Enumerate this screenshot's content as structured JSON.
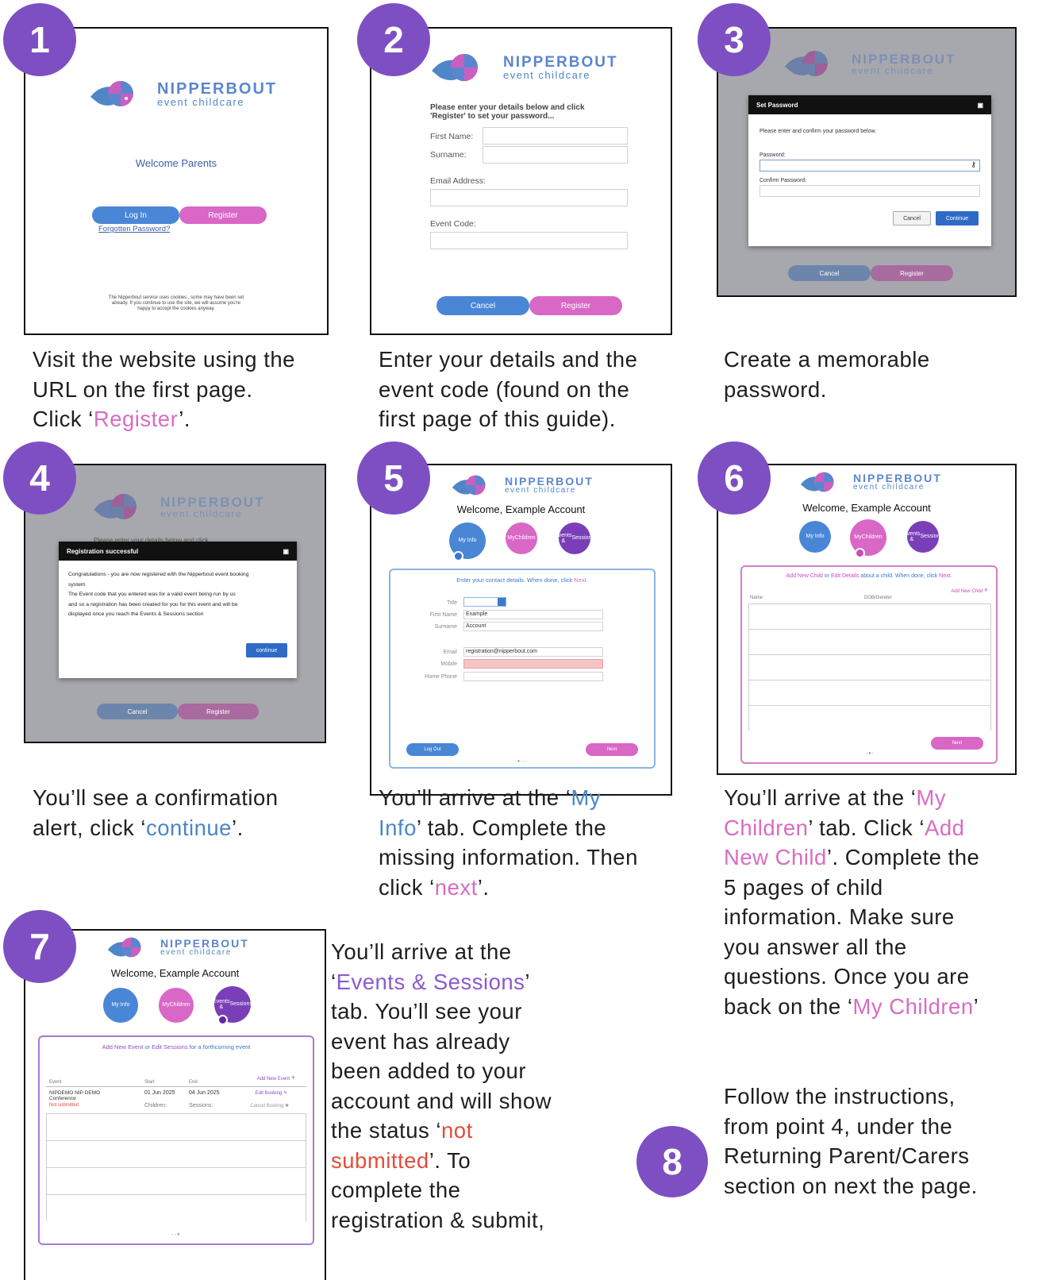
{
  "logo": {
    "name": "NIPPERBOUT",
    "sub": "event childcare"
  },
  "steps": [
    {
      "num": "1",
      "caption": [
        "Visit the website using the",
        "URL on the first page.",
        "Click ‘",
        "Register",
        "’."
      ]
    },
    {
      "num": "2",
      "caption": [
        "Enter your details and the",
        "event code (found on the",
        "first page of this guide)."
      ]
    },
    {
      "num": "3",
      "caption": [
        "Create a memorable",
        "password."
      ]
    },
    {
      "num": "4",
      "caption": [
        "You’ll see a confirmation",
        "alert, click ‘",
        "continue",
        "’."
      ]
    },
    {
      "num": "5",
      "caption": [
        "You’ll arrive at the ‘",
        "My",
        "Info",
        "’ tab.  Complete the",
        "missing information. Then",
        "click ‘",
        "next",
        "’."
      ]
    },
    {
      "num": "6",
      "caption": [
        "You’ll arrive at the ‘",
        "My",
        "Children",
        "’ tab.  Click ‘",
        "Add",
        "New Child",
        "’. Complete the",
        "5 pages of child",
        "information. Make sure",
        "you answer all the",
        "questions. Once you are",
        "back on the ‘",
        "My Children",
        "’"
      ]
    },
    {
      "num": "7",
      "caption": [
        "You’ll arrive at the",
        "‘",
        "Events & Sessions",
        "’",
        "tab.  You’ll see your",
        "event has already",
        "been added to your",
        "account and will show",
        "the status ‘",
        "not",
        "submitted",
        "’.  To",
        "complete the",
        "registration & submit,"
      ]
    },
    {
      "num": "8",
      "caption": [
        "Follow the instructions,",
        "from point 4, under the",
        "Returning Parent/Carers",
        "section on next the page."
      ]
    }
  ],
  "s1": {
    "welcome": "Welcome Parents",
    "login": "Log In",
    "register": "Register",
    "forgot": "Forgotten Password?",
    "cookie": [
      "The Nipperbout service uses cookies , some may have been set",
      "already. If you continue to use the site, we will assume you're",
      "happy to accept the cookies anyway."
    ]
  },
  "s2": {
    "intro": [
      "Please enter your details below and click",
      "'Register' to set your password..."
    ],
    "first": "First Name:",
    "surname": "Surname:",
    "email": "Email Address:",
    "code": "Event Code:",
    "cancel": "Cancel",
    "register": "Register"
  },
  "s3": {
    "title": "Set Password",
    "intro": "Please enter and confirm your password below.",
    "password": "Password:",
    "confirm": "Confirm Password:",
    "cancel": "Cancel",
    "continue": "Continue",
    "bg_cancel": "Cancel",
    "bg_register": "Register"
  },
  "s4": {
    "title": "Registration successful",
    "lines": [
      "Congratulations - you are now registered with the Nipperbout event booking",
      "system",
      "The Event code that you entered was for a valid event being run by us",
      "and so a registration has been created for you for this event and will be",
      "displayed once you reach the Events & Sessions section"
    ],
    "bg_text": "Please enter your details below and click",
    "continue": "continue",
    "bg_cancel": "Cancel",
    "bg_register": "Register"
  },
  "account": {
    "welcome": "Welcome, Example Account",
    "myinfo": "My Info",
    "mychildren": [
      "My",
      "Children"
    ],
    "events": [
      "Events &",
      "Sessions"
    ]
  },
  "s5": {
    "instr": "Enter your contact details.  When done, click ",
    "instr_next": "Next.",
    "title": "Title",
    "first": "First Name",
    "first_val": "Example",
    "surname": "Surname",
    "surname_val": "Account",
    "email": "Email",
    "email_val": "registration@nipperbout.com",
    "mobile": "Mobile",
    "home": "Home Phone",
    "logout": "Log Out",
    "next": "Next"
  },
  "s6": {
    "instr_a": "Add New Child",
    "instr_b": " or ",
    "instr_c": "Edit Details",
    "instr_d": " about a child. When done, click ",
    "instr_e": "Next.",
    "add": "Add New Child",
    "col_name": "Name",
    "col_dob": "DOB/Gender",
    "next": "Next"
  },
  "s7": {
    "instr_a": "Add New Event",
    "instr_b": " or ",
    "instr_c": "Edit Sessions",
    "instr_d": " for a forthcoming event",
    "add": "Add New Event",
    "col_event": "Event",
    "col_start": "Start",
    "col_end": "End",
    "event_name": [
      "NIPDEMO NIP DEMO",
      "Conference"
    ],
    "status": "Not submitted",
    "start": "01 Jun 2025",
    "end": "04 Jun 2025",
    "children": "Children:",
    "sessions": "Sessions:",
    "edit": "Edit Booking",
    "cancel": "Cancel Booking"
  },
  "colors": {
    "purple": "#7e4fc2",
    "pink": "#d967c5",
    "blue": "#4a86d6",
    "red": "#e44b3a"
  }
}
